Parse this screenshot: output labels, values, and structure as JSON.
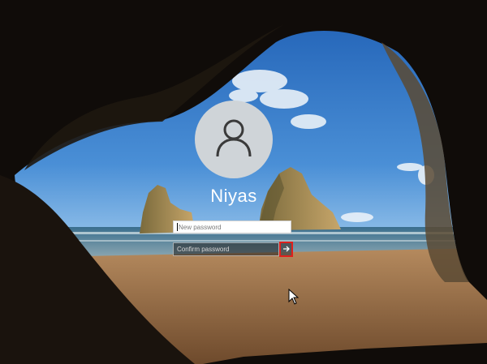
{
  "user": {
    "name": "Niyas"
  },
  "fields": {
    "new_password_placeholder": "New password",
    "confirm_password_placeholder": "Confirm password"
  },
  "icons": {
    "avatar": "user-silhouette-icon",
    "submit": "arrow-right-icon",
    "pointer": "mouse-pointer-icon"
  },
  "colors": {
    "highlight_border": "#e0201c",
    "avatar_bg": "#cfd4d8"
  }
}
